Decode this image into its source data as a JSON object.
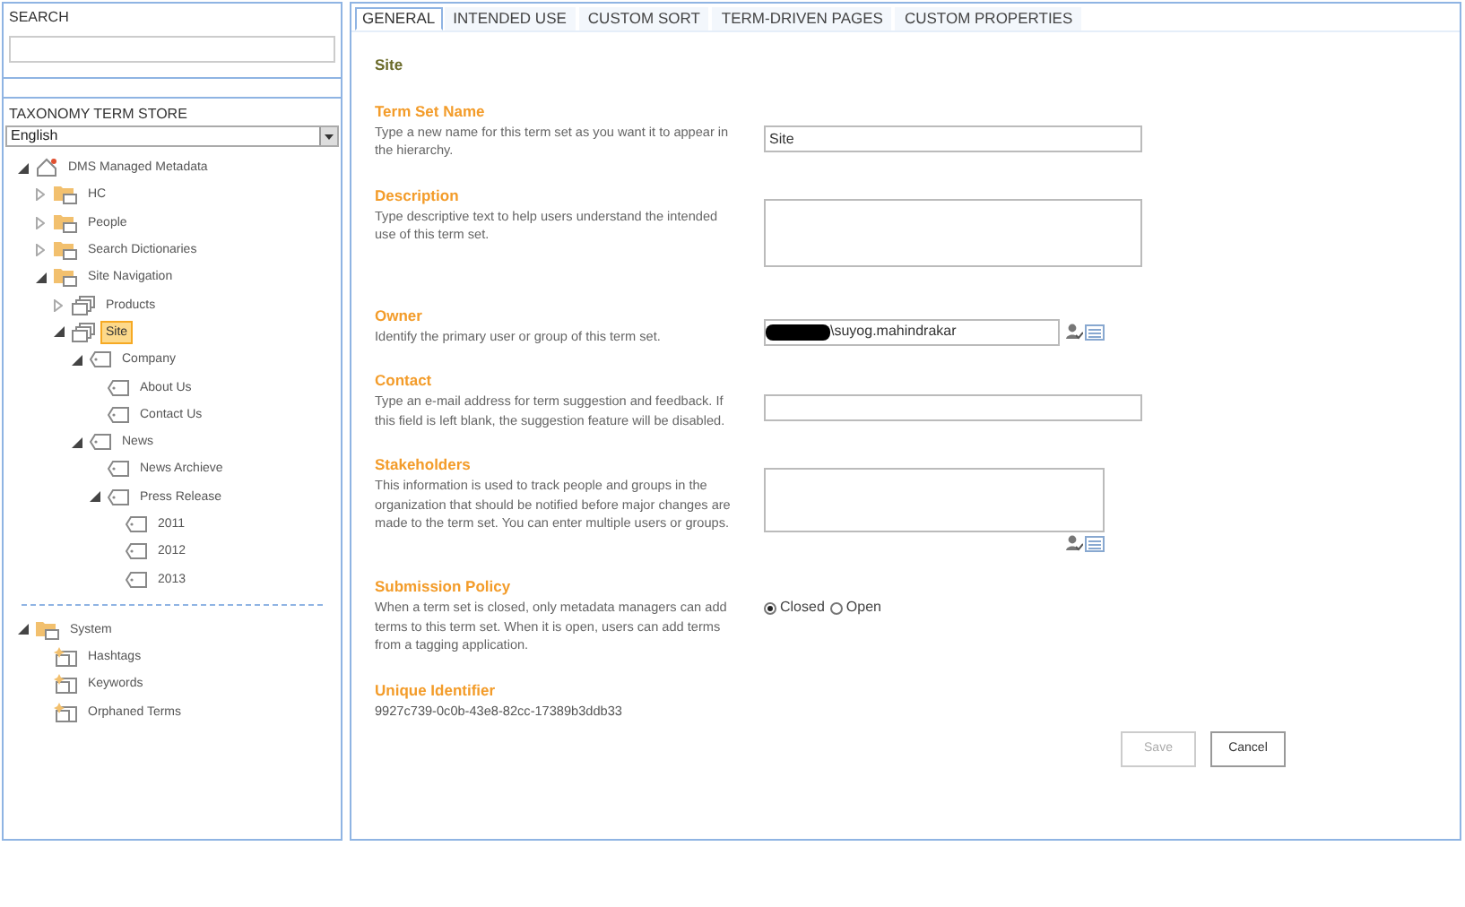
{
  "search": {
    "label": "SEARCH"
  },
  "term_store": {
    "label": "TAXONOMY TERM STORE",
    "language": "English"
  },
  "tree": [
    {
      "label": "DMS Managed Metadata",
      "kind": "store",
      "expanded": true,
      "selected": false,
      "children": [
        {
          "label": "HC",
          "kind": "group",
          "expanded": false,
          "selected": false
        },
        {
          "label": "People",
          "kind": "group",
          "expanded": false,
          "selected": false
        },
        {
          "label": "Search Dictionaries",
          "kind": "group",
          "expanded": false,
          "selected": false
        },
        {
          "label": "Site Navigation",
          "kind": "group",
          "expanded": true,
          "selected": false,
          "children": [
            {
              "label": "Products",
              "kind": "termset",
              "expanded": false,
              "selected": false
            },
            {
              "label": "Site",
              "kind": "termset",
              "expanded": true,
              "selected": true,
              "children": [
                {
                  "label": "Company",
                  "kind": "term",
                  "expanded": true,
                  "selected": false,
                  "children": [
                    {
                      "label": "About Us",
                      "kind": "term",
                      "selected": false
                    },
                    {
                      "label": "Contact Us",
                      "kind": "term",
                      "selected": false
                    }
                  ]
                },
                {
                  "label": "News",
                  "kind": "term",
                  "expanded": true,
                  "selected": false,
                  "children": [
                    {
                      "label": "News Archieve",
                      "kind": "term",
                      "selected": false
                    },
                    {
                      "label": "Press Release",
                      "kind": "term",
                      "expanded": true,
                      "selected": false,
                      "children": [
                        {
                          "label": "2011",
                          "kind": "term",
                          "selected": false
                        },
                        {
                          "label": "2012",
                          "kind": "term",
                          "selected": false
                        },
                        {
                          "label": "2013",
                          "kind": "term",
                          "selected": false
                        }
                      ]
                    }
                  ]
                }
              ]
            }
          ]
        }
      ]
    }
  ],
  "system_tree": [
    {
      "label": "System",
      "kind": "group",
      "expanded": true,
      "selected": false,
      "children": [
        {
          "label": "Hashtags",
          "kind": "systemset",
          "selected": false
        },
        {
          "label": "Keywords",
          "kind": "systemset",
          "selected": false
        },
        {
          "label": "Orphaned Terms",
          "kind": "systemset",
          "selected": false
        }
      ]
    }
  ],
  "tabs": [
    {
      "label": "GENERAL",
      "selected": true
    },
    {
      "label": "INTENDED USE",
      "selected": false
    },
    {
      "label": "CUSTOM SORT",
      "selected": false
    },
    {
      "label": "TERM-DRIVEN PAGES",
      "selected": false
    },
    {
      "label": "CUSTOM PROPERTIES",
      "selected": false
    }
  ],
  "heading": "Site",
  "sections": [
    {
      "kind": "text",
      "title": "Term Set Name",
      "description": "Type a new name for this term set as you want it to appear in the hierarchy.",
      "value": "Site"
    },
    {
      "kind": "textarea",
      "title": "Description",
      "description": "Type descriptive text to help users understand the intended use of this term set."
    },
    {
      "kind": "people",
      "title": "Owner",
      "description": "Identify the primary user or group of this term set.",
      "value": "\\suyog.mahindrakar",
      "redacted": true
    },
    {
      "kind": "text",
      "title": "Contact",
      "description": "Type an e-mail address for term suggestion and feedback. If this field is left blank, the suggestion feature will be disabled."
    },
    {
      "kind": "people-multi",
      "title": "Stakeholders",
      "description": "This information is used to track people and groups in the organization that should be notified before major changes are made to the term set. You can enter multiple users or groups."
    },
    {
      "kind": "radio",
      "title": "Submission Policy",
      "description": "When a term set is closed, only metadata managers can add terms to this term set. When it is open, users can add terms from a tagging application.",
      "options": [
        {
          "label": "Closed",
          "selected": true
        },
        {
          "label": "Open",
          "selected": false
        }
      ]
    },
    {
      "kind": "static",
      "title": "Unique Identifier",
      "value": "9927c739-0c0b-43e8-82cc-17389b3ddb33"
    }
  ],
  "buttons": [
    {
      "label": "Save",
      "disabled": true
    },
    {
      "label": "Cancel",
      "disabled": false
    }
  ]
}
